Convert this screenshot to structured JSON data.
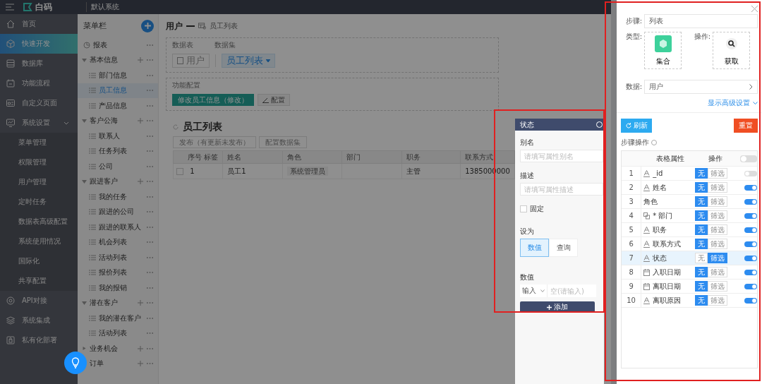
{
  "topbar": {
    "logo": "白码",
    "system": "默认系统"
  },
  "sidebar": {
    "items": [
      {
        "label": "首页",
        "selected": false
      },
      {
        "label": "快速开发",
        "selected": true
      },
      {
        "label": "数据库",
        "selected": false
      },
      {
        "label": "功能流程",
        "selected": false
      },
      {
        "label": "自定义页面",
        "selected": false
      },
      {
        "label": "系统设置",
        "selected": false,
        "expanded": true,
        "children": [
          {
            "label": "菜单管理"
          },
          {
            "label": "权限管理"
          },
          {
            "label": "用户管理"
          },
          {
            "label": "定时任务"
          },
          {
            "label": "数据表高级配置"
          },
          {
            "label": "系统使用情况"
          },
          {
            "label": "国际化"
          },
          {
            "label": "共享配置"
          }
        ]
      },
      {
        "label": "API对接",
        "selected": false
      },
      {
        "label": "系统集成",
        "selected": false
      },
      {
        "label": "私有化部署",
        "selected": false
      }
    ]
  },
  "menu": {
    "title": "菜单栏",
    "items": [
      {
        "label": "报表",
        "kind": "report"
      },
      {
        "label": "基本信息",
        "kind": "group",
        "expanded": true,
        "children": [
          {
            "label": "部门信息",
            "selected": false
          },
          {
            "label": "员工信息",
            "selected": true
          },
          {
            "label": "产品信息",
            "selected": false
          }
        ]
      },
      {
        "label": "客户公海",
        "kind": "group",
        "expanded": true,
        "children": [
          {
            "label": "联系人",
            "selected": false
          },
          {
            "label": "任务列表",
            "selected": false
          },
          {
            "label": "公司",
            "selected": false
          }
        ]
      },
      {
        "label": "跟进客户",
        "kind": "group",
        "expanded": true,
        "children": [
          {
            "label": "我的任务",
            "selected": false
          },
          {
            "label": "跟进的公司",
            "selected": false
          },
          {
            "label": "跟进的联系人",
            "selected": false
          },
          {
            "label": "机会列表",
            "selected": false
          },
          {
            "label": "活动列表",
            "selected": false
          },
          {
            "label": "报价列表",
            "selected": false
          },
          {
            "label": "我的报销",
            "selected": false
          }
        ]
      },
      {
        "label": "潜在客户",
        "kind": "group",
        "expanded": true,
        "children": [
          {
            "label": "我的潜在客户",
            "selected": false
          },
          {
            "label": "活动列表",
            "selected": false
          }
        ]
      },
      {
        "label": "业务机会",
        "kind": "group",
        "expanded": false
      },
      {
        "label": "订单",
        "kind": "group",
        "expanded": false
      }
    ]
  },
  "main": {
    "title": "用户",
    "subtitle": "员工列表",
    "data_table_label": "数据表",
    "dataset_label": "数据集",
    "table_chip": "用户",
    "dataset_chip": "员工列表",
    "function_label": "功能配置",
    "action_button": "修改员工信息（修改）",
    "config_button": "配置",
    "list_title": "员工列表",
    "publish_button": "发布（有更新未发布）",
    "dataset_button": "配置数据集",
    "columns": [
      "序号",
      "标签",
      "姓名",
      "角色",
      "部门",
      "职务",
      "联系方式"
    ],
    "rows": [
      {
        "index": "1",
        "name": "员工1",
        "role": "系统管理员",
        "position": "主管",
        "phone": "1385000000",
        "checked": false
      }
    ]
  },
  "state_panel": {
    "title": "状态",
    "alias_label": "别名",
    "alias_placeholder": "请填写属性别名",
    "desc_label": "描述",
    "desc_placeholder": "请填写属性描述",
    "fixed": {
      "label": "固定",
      "checked": false
    },
    "set_as_label": "设为",
    "options": [
      {
        "label": "数值",
        "selected": true
      },
      {
        "label": "查询",
        "selected": false
      }
    ],
    "value_label": "数值",
    "value_select": "输入",
    "value_placeholder": "空(请输入)",
    "add_button": "添加"
  },
  "drawer": {
    "step_label": "步骤:",
    "step_value": "列表",
    "type_label": "类型:",
    "type_card": "集合",
    "operation_label": "操作:",
    "operation_card": "获取",
    "data_label": "数据:",
    "data_value": "用户",
    "advanced_link": "显示高级设置",
    "refresh_button": "刷新",
    "reset_button": "重置",
    "ops_label": "步骤操作",
    "header_toggle_on": false,
    "columns": [
      "表格属性",
      "操作"
    ],
    "rows": [
      {
        "index": "1",
        "label": "_id",
        "kind": "text",
        "selected": false,
        "modes": [
          {
            "label": "无",
            "selected": true
          },
          {
            "label": "筛选",
            "selected": false
          }
        ],
        "on": false
      },
      {
        "index": "2",
        "label": "姓名",
        "kind": "text",
        "selected": false,
        "modes": [
          {
            "label": "无",
            "selected": true
          },
          {
            "label": "筛选",
            "selected": false
          }
        ],
        "on": true
      },
      {
        "index": "3",
        "label": "角色",
        "kind": "plain",
        "selected": false,
        "modes": [
          {
            "label": "无",
            "selected": true
          },
          {
            "label": "筛选",
            "selected": false
          }
        ],
        "on": true
      },
      {
        "index": "4",
        "label": "* 部门",
        "kind": "relation",
        "selected": false,
        "modes": [
          {
            "label": "无",
            "selected": true
          },
          {
            "label": "筛选",
            "selected": false
          }
        ],
        "on": true
      },
      {
        "index": "5",
        "label": "职务",
        "kind": "text",
        "selected": false,
        "modes": [
          {
            "label": "无",
            "selected": true
          },
          {
            "label": "筛选",
            "selected": false
          }
        ],
        "on": true
      },
      {
        "index": "6",
        "label": "联系方式",
        "kind": "text",
        "selected": false,
        "modes": [
          {
            "label": "无",
            "selected": true
          },
          {
            "label": "筛选",
            "selected": false
          }
        ],
        "on": true
      },
      {
        "index": "7",
        "label": "状态",
        "kind": "text",
        "selected": true,
        "modes": [
          {
            "label": "无",
            "selected": false
          },
          {
            "label": "筛选",
            "selected": true
          }
        ],
        "on": true
      },
      {
        "index": "8",
        "label": "入职日期",
        "kind": "date",
        "selected": false,
        "modes": [
          {
            "label": "无",
            "selected": true
          },
          {
            "label": "筛选",
            "selected": false
          }
        ],
        "on": true
      },
      {
        "index": "9",
        "label": "离职日期",
        "kind": "date",
        "selected": false,
        "modes": [
          {
            "label": "无",
            "selected": true
          },
          {
            "label": "筛选",
            "selected": false
          }
        ],
        "on": true
      },
      {
        "index": "10",
        "label": "离职原因",
        "kind": "text",
        "selected": false,
        "modes": [
          {
            "label": "无",
            "selected": true
          },
          {
            "label": "筛选",
            "selected": false
          }
        ],
        "on": true
      }
    ]
  }
}
